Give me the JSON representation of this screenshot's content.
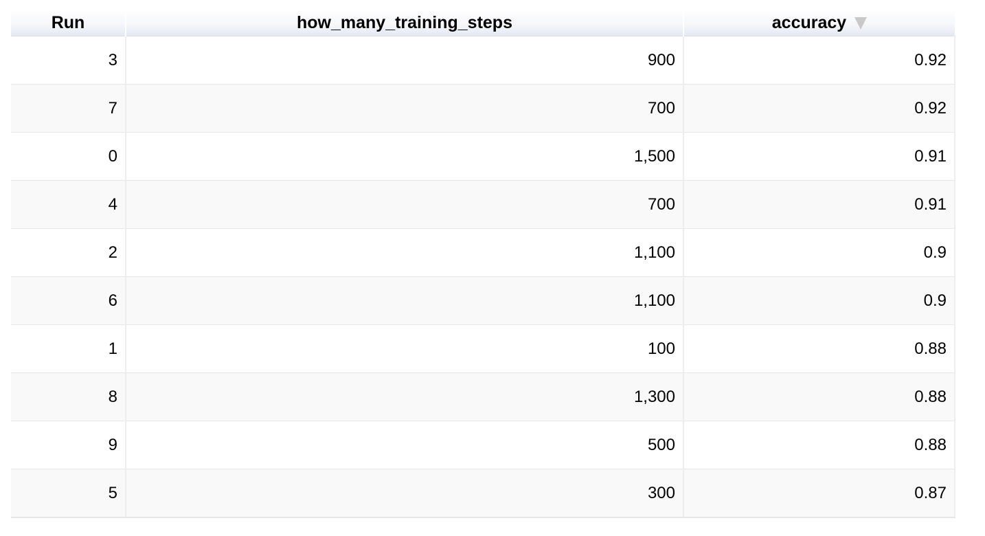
{
  "table": {
    "columns": [
      {
        "label": "Run"
      },
      {
        "label": "how_many_training_steps"
      },
      {
        "label": "accuracy",
        "sorted": "descending"
      }
    ],
    "rows": [
      {
        "run": "3",
        "steps": "900",
        "accuracy": "0.92"
      },
      {
        "run": "7",
        "steps": "700",
        "accuracy": "0.92"
      },
      {
        "run": "0",
        "steps": "1,500",
        "accuracy": "0.91"
      },
      {
        "run": "4",
        "steps": "700",
        "accuracy": "0.91"
      },
      {
        "run": "2",
        "steps": "1,100",
        "accuracy": "0.9"
      },
      {
        "run": "6",
        "steps": "1,100",
        "accuracy": "0.9"
      },
      {
        "run": "1",
        "steps": "100",
        "accuracy": "0.88"
      },
      {
        "run": "8",
        "steps": "1,300",
        "accuracy": "0.88"
      },
      {
        "run": "9",
        "steps": "500",
        "accuracy": "0.88"
      },
      {
        "run": "5",
        "steps": "300",
        "accuracy": "0.87"
      }
    ]
  }
}
